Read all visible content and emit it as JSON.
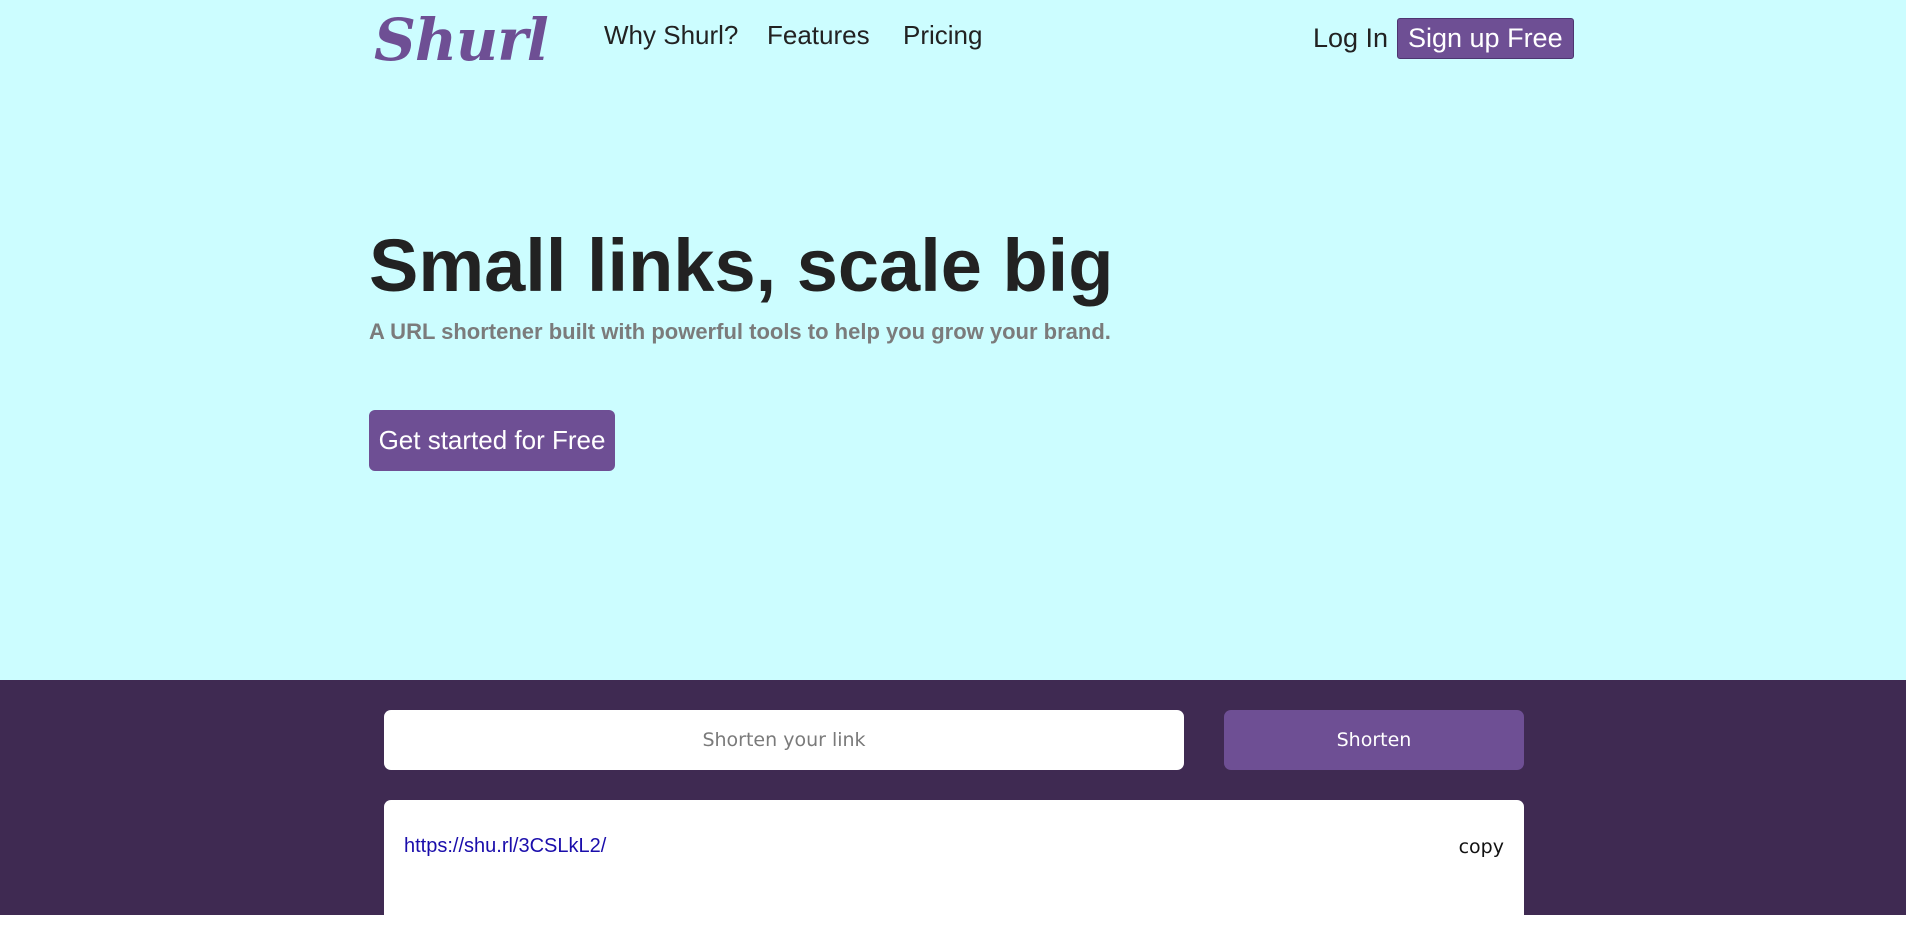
{
  "header": {
    "logo": "Shurl",
    "nav": [
      {
        "label": "Why Shurl?"
      },
      {
        "label": "Features"
      },
      {
        "label": "Pricing"
      }
    ],
    "login_label": "Log In",
    "signup_label": "Sign up Free"
  },
  "hero": {
    "headline": "Small links, scale big",
    "subheadline": "A URL shortener built with powerful tools to help you grow your brand.",
    "cta_label": "Get started for Free"
  },
  "shortener": {
    "input_placeholder": "Shorten your link",
    "input_value": "",
    "button_label": "Shorten",
    "result": {
      "short_url": "https://shu.rl/3CSLkL2/",
      "copy_label": "copy"
    }
  },
  "colors": {
    "hero_background": "#ccfdff",
    "brand_purple": "#6e4f94",
    "dark_purple": "#3f2a52"
  }
}
